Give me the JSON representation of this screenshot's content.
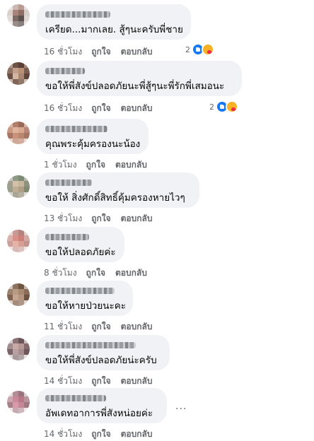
{
  "labels": {
    "like": "ถูกใจ",
    "reply": "ตอบกลับ"
  },
  "colors": {
    "bubble": "#f0f2f5",
    "meta_text": "#65676b",
    "like_blue": "#1877f2"
  },
  "comments": [
    {
      "text": "เครียด...มากเลย. สู้ๆนะครับพี่ชาย",
      "time": "16 ชั่วโมง",
      "reactions": {
        "count": "2",
        "icons": [
          "like-icon",
          "care-icon"
        ]
      }
    },
    {
      "text": "ขอให้พี่สังข์ปลอดภัยนะพี่สู้ๆนะพี่รักพี่เสมอนะ",
      "time": "16 ชั่วโมง",
      "reactions": {
        "count": "2",
        "icons": [
          "like-icon",
          "care-icon"
        ]
      }
    },
    {
      "text": "คุณพระคุ้มครองนะน้อง",
      "time": "1 ชั่วโมง"
    },
    {
      "text": "ขอให้ สิ่งศักดิ์สิทธิ์คุ้มครองหายไวๆ",
      "time": "13 ชั่วโมง"
    },
    {
      "text": "ขอให้ปลอดภัยค่ะ",
      "time": "8 ชั่วโมง"
    },
    {
      "text": "ขอให้หายป่วยนะคะ",
      "time": "11 ชั่วโมง"
    },
    {
      "text": "ขอให้พี่สังข์ปลอดภัยน่ะครับ",
      "time": "14 ชั่วโมง"
    },
    {
      "text": "อัพเดทอาการพี่สังหน่อยค่ะ",
      "time": "14 ชั่วโมง",
      "more": "..."
    }
  ]
}
